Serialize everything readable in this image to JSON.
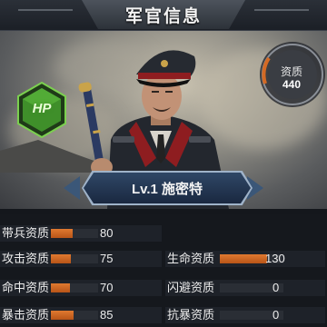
{
  "header": {
    "title": "军官信息"
  },
  "badge": {
    "label": "HP",
    "icon": "hexagon-hp-icon"
  },
  "qualification": {
    "label": "资质",
    "value": "440"
  },
  "nameplate": {
    "text": "Lv.1 施密特"
  },
  "stats_left": [
    {
      "label": "带兵资质",
      "value": "80",
      "fill": 0.46
    },
    {
      "label": "攻击资质",
      "value": "75",
      "fill": 0.43
    },
    {
      "label": "命中资质",
      "value": "70",
      "fill": 0.4
    },
    {
      "label": "暴击资质",
      "value": "85",
      "fill": 0.49
    }
  ],
  "stats_right": [
    {
      "label": "生命资质",
      "value": "130",
      "fill": 0.74
    },
    {
      "label": "闪避资质",
      "value": "0",
      "fill": 0
    },
    {
      "label": "抗暴资质",
      "value": "0",
      "fill": 0
    }
  ],
  "colors": {
    "bar": "#d46a24",
    "badge": "#3f8f2a",
    "nameplate": "#243752"
  }
}
